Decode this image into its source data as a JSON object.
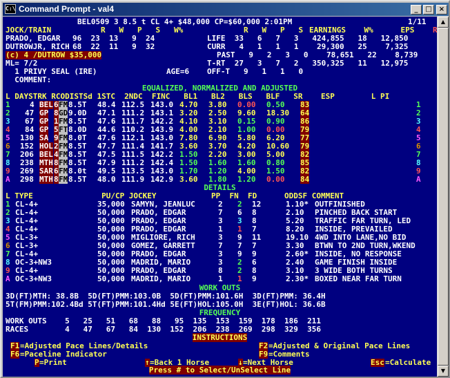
{
  "window": {
    "title": "Command Prompt - val4",
    "min": "_",
    "max": "□",
    "close": "×"
  },
  "top": {
    "line1": "BEL0509 3 8.5 t CL 4+ $48,000 CP=$60,000 2:01PM",
    "page": "1/11",
    "hdr_left": "JOCK/TRAIN",
    "hdr_cols": "R   W   P   S   W%",
    "hdr_right_cols": "R   W   P   S",
    "hdr_earn": "EARNINGS    W%      EPS",
    "hdr_r": "R",
    "jock": "PRADO, EDGAR",
    "jock_stats": "96  23  13   9  24",
    "life": "LIFE  33   6   7   3   424,855   18   12,850",
    "train": "DUTROWJR, RICH",
    "train_stats": "68  22  11   9  32",
    "curr": "CURR   4   1   1   1    29,300   25    7,325",
    "claim": "(c) 4 /DUTROW $35,000",
    "past": "PAST   9   2   3   0    78,651   22    8,739",
    "ml": "ML= 7/2",
    "trt": "T-RT  27   3   7   2   350,325   11   12,975",
    "privy": "  1 PRIVY SEAL (IRE)",
    "age": "AGE=6",
    "offt": "OFF-T   9   1   1   0",
    "comment": "  COMMENT:"
  },
  "section_equalized": "EQUALIZED, NORMALIZED AND ADJUSTED",
  "eq_header": "L DAYSTRK RCODISTSd 1STC  2NDC  FINC   BL1   BL2   BLS   BLF   SR    ESP        L PI",
  "eq_rows": [
    {
      "l": "1",
      "days": "4",
      "trk": "BEL",
      "n": "6",
      "fm": "FM",
      "dist": "8.5T",
      "c1": "48.4",
      "c2": "112.5",
      "fin": "143.0",
      "bl1": "4.70",
      "bl2": "3.80",
      "bls": "0.00",
      "blf": "0.50",
      "sr": "83",
      "rl": "1",
      "lc": "gr"
    },
    {
      "l": "2",
      "days": "47",
      "trk": "GP",
      "n": "8",
      "fm": "GD",
      "dist": "9.0D",
      "c1": "47.1",
      "c2": "111.2",
      "fin": "143.1",
      "bl1": "3.20",
      "bl2": "2.50",
      "bls": "9.60",
      "blf": "18.30",
      "sr": "64",
      "rl": "2",
      "lc": "gr"
    },
    {
      "l": "3",
      "days": "67",
      "trk": "GP",
      "n": "1",
      "fm": "FM",
      "dist": "8.5T",
      "c1": "47.6",
      "c2": "111.7",
      "fin": "142.2",
      "bl1": "4.10",
      "bl2": "3.10",
      "bls": "0.15",
      "blf": "0.90",
      "sr": "86",
      "rl": "3",
      "lc": "c"
    },
    {
      "l": "4",
      "days": "84",
      "trk": "GP",
      "n": "5",
      "fm": "FT",
      "dist": "8.0D",
      "c1": "44.6",
      "c2": "110.2",
      "fin": "143.9",
      "bl1": "4.00",
      "bl2": "2.10",
      "bls": "1.00",
      "blf": "0.00",
      "sr": "79",
      "rl": "4",
      "lc": "r"
    },
    {
      "l": "5",
      "days": "130",
      "trk": "SA",
      "n": "9",
      "fm": "FM",
      "dist": "8.0T",
      "c1": "47.6",
      "c2": "112.1",
      "fin": "143.0",
      "bl1": "7.80",
      "bl2": "6.90",
      "bls": "5.80",
      "blf": "6.20",
      "sr": "77",
      "rl": "5",
      "lc": "m"
    },
    {
      "l": "6",
      "days": "152",
      "trk": "HOL",
      "n": "2",
      "fm": "FM",
      "dist": "8.5T",
      "c1": "47.7",
      "c2": "111.4",
      "fin": "141.7",
      "bl1": "3.60",
      "bl2": "3.70",
      "bls": "4.20",
      "blf": "10.60",
      "sr": "79",
      "rl": "6",
      "lc": "o"
    },
    {
      "l": "7",
      "days": "206",
      "trk": "BEL",
      "n": "4",
      "fm": "FM",
      "dist": "8.5T",
      "c1": "47.5",
      "c2": "111.5",
      "fin": "142.2",
      "bl1": "1.50",
      "bl2": "2.20",
      "bls": "3.00",
      "blf": "5.00",
      "sr": "82",
      "rl": "7",
      "lc": "gr"
    },
    {
      "l": "8",
      "days": "238",
      "trk": "MTH",
      "n": "8",
      "fm": "FM",
      "dist": "8.5T",
      "c1": "47.9",
      "c2": "111.2",
      "fin": "142.4",
      "bl1": "1.50",
      "bl2": "1.60",
      "bls": "1.60",
      "blf": "0.80",
      "sr": "85",
      "rl": "8",
      "lc": "c"
    },
    {
      "l": "9",
      "days": "269",
      "trk": "SAR",
      "n": "6",
      "fm": "FM",
      "dist": "8.0t",
      "c1": "49.5",
      "c2": "113.5",
      "fin": "143.0",
      "bl1": "1.70",
      "bl2": "1.20",
      "bls": "4.00",
      "blf": "1.50",
      "sr": "82",
      "rl": "9",
      "lc": "r"
    },
    {
      "l": "A",
      "days": "298",
      "trk": "MTH",
      "n": "8",
      "fm": "FM",
      "dist": "8.5T",
      "c1": "48.0",
      "c2": "111.9",
      "fin": "142.9",
      "bl1": "3.60",
      "bl2": "1.80",
      "bls": "1.20",
      "blf": "0.00",
      "sr": "84",
      "rl": "A",
      "lc": "m"
    }
  ],
  "section_details": "DETAILS",
  "det_header": "L TYPE               PU/CP JOCKEY            PP  FN  FD      ODDSF COMMENT",
  "det_rows": [
    {
      "l": "1",
      "type": "CL-4+",
      "pu": "35,000",
      "jockey": "SAMYN, JEANLUC",
      "pp": "2",
      "fn": "2",
      "fd": "12",
      "odds": "1.10*",
      "comment": "OUTFINISHED",
      "lc": "gr",
      "fnc": "gr"
    },
    {
      "l": "2",
      "type": "CL-4+",
      "pu": "50,000",
      "jockey": "PRADO, EDGAR",
      "pp": "7",
      "fn": "6",
      "fd": "8",
      "odds": "2.10",
      "comment": "PINCHED BACK START",
      "lc": "gr",
      "fnc": "w"
    },
    {
      "l": "3",
      "type": "CL-4+",
      "pu": "50,000",
      "jockey": "PRADO, EDGAR",
      "pp": "3",
      "fn": "3",
      "fd": "8",
      "odds": "5.20",
      "comment": "TRAFFIC FAR TURN, LED",
      "lc": "c",
      "fnc": "c"
    },
    {
      "l": "4",
      "type": "CL-4+",
      "pu": "50,000",
      "jockey": "PRADO, EDGAR",
      "pp": "1",
      "fn": "1",
      "fd": "7",
      "odds": "8.20",
      "comment": "INSIDE, PREVAILED",
      "lc": "r",
      "fnc": "r"
    },
    {
      "l": "5",
      "type": "CL-3+",
      "pu": "50,000",
      "jockey": "MIGLIORE, RICH",
      "pp": "3",
      "fn": "9",
      "fd": "11",
      "odds": "19.10",
      "comment": "4WD INTO LANE,NO BID",
      "lc": "m",
      "fnc": "w"
    },
    {
      "l": "6",
      "type": "CL-3+",
      "pu": "50,000",
      "jockey": "GOMEZ, GARRETT",
      "pp": "7",
      "fn": "7",
      "fd": "7",
      "odds": "3.30",
      "comment": "BTWN TO 2ND TURN,WKEND",
      "lc": "o",
      "fnc": "w"
    },
    {
      "l": "7",
      "type": "CL-4+",
      "pu": "50,000",
      "jockey": "PRADO, EDGAR",
      "pp": "3",
      "fn": "9",
      "fd": "9",
      "odds": "2.60*",
      "comment": "INSIDE, NO RESPONSE",
      "lc": "gr",
      "fnc": "w"
    },
    {
      "l": "8",
      "type": "OC-3+NW3",
      "pu": "50,000",
      "jockey": "MADRID, MARIO",
      "pp": "3",
      "fn": "2",
      "fd": "6",
      "odds": "2.40",
      "comment": "GAME FINISH INSIDE",
      "lc": "c",
      "fnc": "gr"
    },
    {
      "l": "9",
      "type": "CL-4+",
      "pu": "50,000",
      "jockey": "PRADO, EDGAR",
      "pp": "8",
      "fn": "2",
      "fd": "8",
      "odds": "3.10",
      "comment": "3 WIDE BOTH TURNS",
      "lc": "r",
      "fnc": "gr"
    },
    {
      "l": "A",
      "type": "OC-3+NW3",
      "pu": "50,000",
      "jockey": "MADRID, MARIO",
      "pp": "1",
      "fn": "1",
      "fd": "9",
      "odds": "2.30*",
      "comment": "BOXED NEAR FAR TURN",
      "lc": "m",
      "fnc": "r"
    }
  ],
  "section_workouts": "WORK OUTS",
  "workouts": [
    "3D(FT)MTH: 38.8B  5D(FT)PMM:103.0B  5D(FT)PMM:101.6H  3D(FT)PMM: 36.4H",
    "5T(FM)PMM:102.4Bd 5T(FT)PMM:101.4Hd 5E(FT)HOL:105.0H  3E(FT)HOL: 36.6B"
  ],
  "section_frequency": "FREQUENCY",
  "freq_workouts": "WORK OUTS    5   25   51   68   88   95  135  153  159  178  186  211",
  "freq_races": "RACES        4   47   67   84  130  152  206  238  269  298  329  356",
  "section_instructions": "INSTRUCTIONS",
  "instr": {
    "f1k": "F1",
    "f1": "=Adjusted Pace Lines/Details",
    "f2k": "F2",
    "f2": "=Adjusted & Original Pace Lines",
    "f6k": "F6",
    "f6": "=Paceline Indicator",
    "f9k": "F9",
    "f9": "=Comments",
    "pk": "P",
    "p": "=Print",
    "upk": "↑",
    "up": "=Back 1 Horse",
    "dnk": "↓",
    "dn": "=Next Horse",
    "esck": "Esc",
    "esc": "=Calculate"
  },
  "bottom": "Press # to Select/UnSelect Line"
}
